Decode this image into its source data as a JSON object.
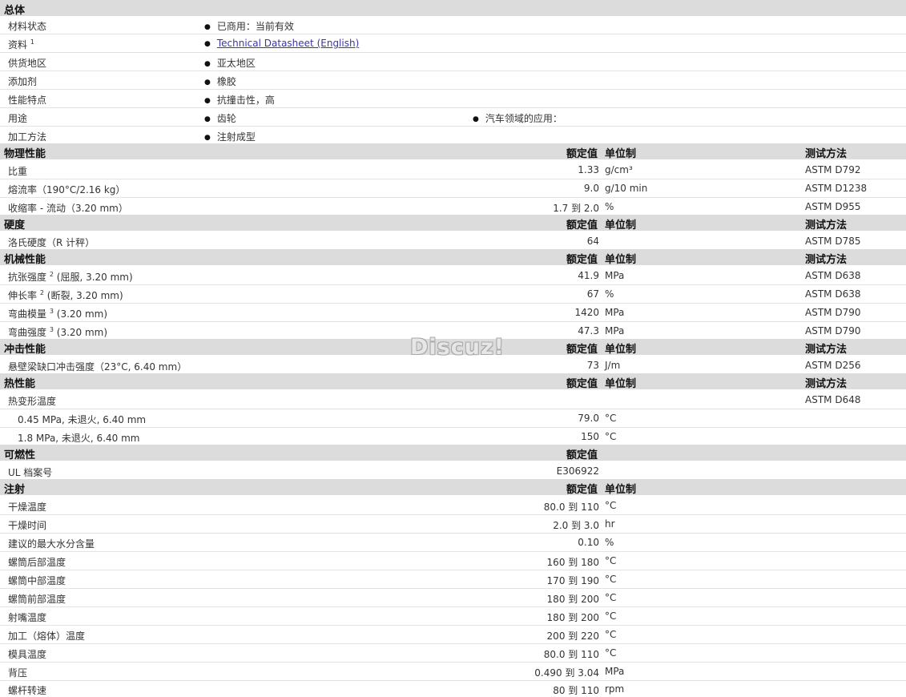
{
  "general": {
    "title": "总体",
    "status_label": "材料状态",
    "status_value": "已商用：当前有效",
    "docs_label": "资料",
    "docs_sup": "1",
    "docs_link": "Technical Datasheet (English)",
    "region_label": "供货地区",
    "region_value": "亚太地区",
    "additive_label": "添加剂",
    "additive_value": "橡胶",
    "feature_label": "性能特点",
    "feature_value": "抗撞击性，高",
    "use_label": "用途",
    "use_value_1": "齿轮",
    "use_value_2": "汽车领域的应用：",
    "process_label": "加工方法",
    "process_value": "注射成型"
  },
  "columns": {
    "nominal": "额定值",
    "unit": "单位制",
    "method": "测试方法"
  },
  "physical": {
    "title": "物理性能",
    "rows": [
      {
        "label": "比重",
        "value": "1.33",
        "unit": "g/cm³",
        "method": "ASTM D792"
      },
      {
        "label": "熔流率（190°C/2.16 kg）",
        "value": "9.0",
        "unit": "g/10 min",
        "method": "ASTM D1238"
      },
      {
        "label": "收缩率 - 流动（3.20 mm）",
        "value": "1.7 到 2.0",
        "unit": "%",
        "method": "ASTM D955"
      }
    ]
  },
  "hardness": {
    "title": "硬度",
    "rows": [
      {
        "label": "洛氏硬度（R 计秤）",
        "value": "64",
        "unit": "",
        "method": "ASTM D785"
      }
    ]
  },
  "mechanical": {
    "title": "机械性能",
    "rows": [
      {
        "label_a": "抗张强度",
        "sup": "2",
        "label_b": "(屈服, 3.20 mm)",
        "value": "41.9",
        "unit": "MPa",
        "method": "ASTM D638"
      },
      {
        "label_a": "伸长率",
        "sup": "2",
        "label_b": "(断裂, 3.20 mm)",
        "value": "67",
        "unit": "%",
        "method": "ASTM D638"
      },
      {
        "label_a": "弯曲模量",
        "sup": "3",
        "label_b": "(3.20 mm)",
        "value": "1420",
        "unit": "MPa",
        "method": "ASTM D790"
      },
      {
        "label_a": "弯曲强度",
        "sup": "3",
        "label_b": "(3.20 mm)",
        "value": "47.3",
        "unit": "MPa",
        "method": "ASTM D790"
      }
    ]
  },
  "impact": {
    "title": "冲击性能",
    "rows": [
      {
        "label": "悬壁梁缺口冲击强度（23°C, 6.40 mm）",
        "value": "73",
        "unit": "J/m",
        "method": "ASTM D256"
      }
    ]
  },
  "thermal": {
    "title": "热性能",
    "hdt_label": "热变形温度",
    "hdt_method": "ASTM D648",
    "rows": [
      {
        "label": "0.45 MPa, 未退火, 6.40 mm",
        "value": "79.0",
        "unit": "°C"
      },
      {
        "label": "1.8 MPa, 未退火, 6.40 mm",
        "value": "150",
        "unit": "°C"
      }
    ]
  },
  "flammability": {
    "title": "可燃性",
    "rows": [
      {
        "label": "UL 档案号",
        "value": "E306922"
      }
    ]
  },
  "injection": {
    "title": "注射",
    "rows": [
      {
        "label": "干燥温度",
        "value": "80.0 到  110",
        "unit": "°C"
      },
      {
        "label": "干燥时间",
        "value": "2.0 到  3.0",
        "unit": "hr"
      },
      {
        "label": "建议的最大水分含量",
        "value": "0.10",
        "unit": "%"
      },
      {
        "label": "螺筒后部温度",
        "value": "160 到  180",
        "unit": "°C"
      },
      {
        "label": "螺筒中部温度",
        "value": "170 到  190",
        "unit": "°C"
      },
      {
        "label": "螺筒前部温度",
        "value": "180 到  200",
        "unit": "°C"
      },
      {
        "label": "射嘴温度",
        "value": "180 到  200",
        "unit": "°C"
      },
      {
        "label": "加工（熔体）温度",
        "value": "200 到  220",
        "unit": "°C"
      },
      {
        "label": "模具温度",
        "value": "80.0 到  110",
        "unit": "°C"
      },
      {
        "label": "背压",
        "value": "0.490 到  3.04",
        "unit": "MPa"
      },
      {
        "label": "螺杆转速",
        "value": "80 到  110",
        "unit": "rpm"
      }
    ]
  },
  "watermark": "Discuz!"
}
